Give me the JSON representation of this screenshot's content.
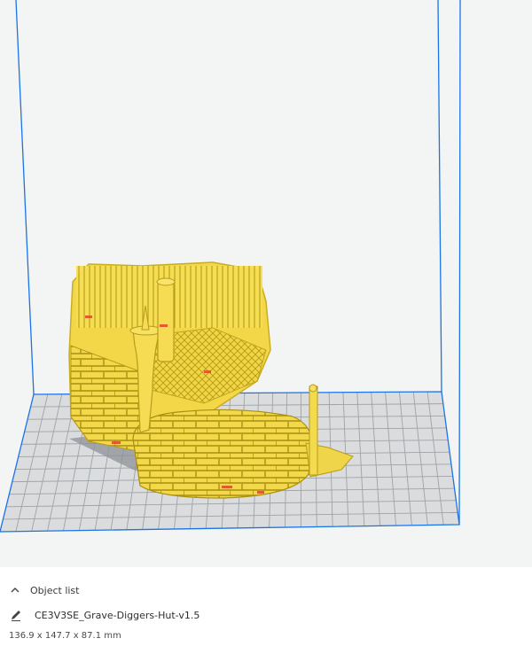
{
  "object_panel": {
    "header_label": "Object list",
    "header_icon": "chevron-up-icon",
    "object_name": "CE3V3SE_Grave-Diggers-Hut-v1.5",
    "name_icon": "pencil-icon",
    "dimensions": "136.9 x 147.7 x 87.1 mm"
  },
  "viewport": {
    "background_color": "#f3f4f4",
    "build_plate_color": "#dadcde",
    "grid_color": "#9ea3a8",
    "volume_outline_color": "#1a73e8",
    "model_color": "#f5dc4f"
  }
}
